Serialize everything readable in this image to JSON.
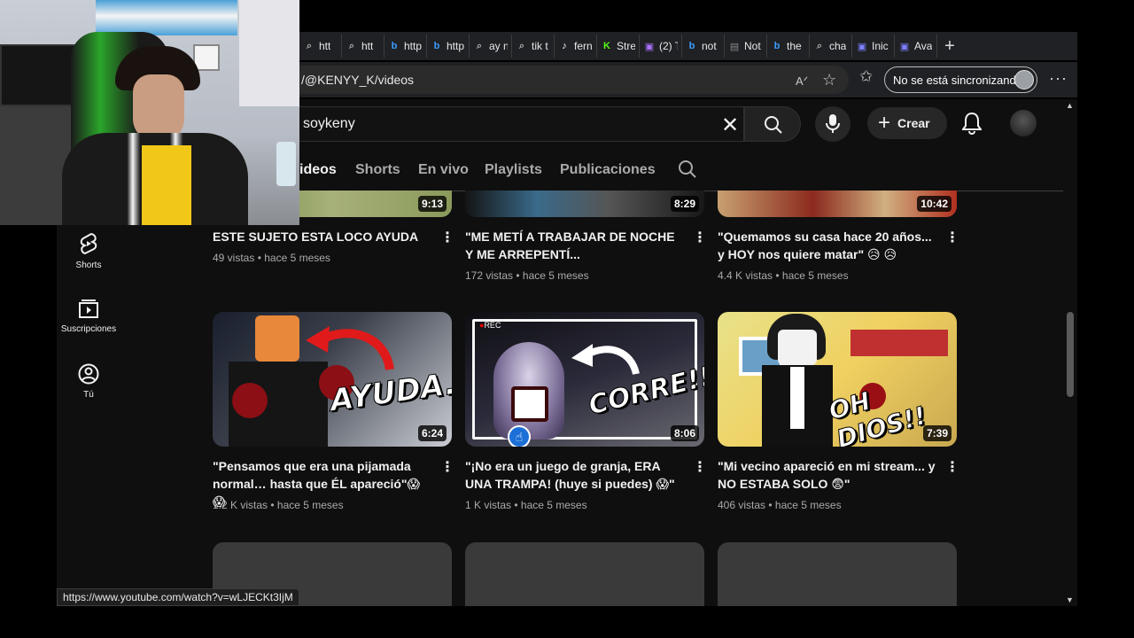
{
  "browser": {
    "tabs": [
      {
        "label": "htt",
        "icon": "search-icon"
      },
      {
        "label": "htt",
        "icon": "search-icon"
      },
      {
        "label": "http",
        "icon": "bing-icon"
      },
      {
        "label": "http",
        "icon": "bing-icon"
      },
      {
        "label": "ay n",
        "icon": "search-icon"
      },
      {
        "label": "tik t",
        "icon": "search-icon"
      },
      {
        "label": "fern",
        "icon": "tiktok-icon"
      },
      {
        "label": "Stre",
        "icon": "kick-icon"
      },
      {
        "label": "(2) T",
        "icon": "twitch-icon"
      },
      {
        "label": "not",
        "icon": "bing-icon"
      },
      {
        "label": "Not",
        "icon": "page-icon"
      },
      {
        "label": "the",
        "icon": "bing-icon"
      },
      {
        "label": "cha",
        "icon": "search-icon"
      },
      {
        "label": "Inic",
        "icon": "app-icon"
      },
      {
        "label": "Ava",
        "icon": "app-icon"
      }
    ],
    "url": "/@KENYY_K/videos",
    "sync_label": "No se está sincronizando",
    "status_url": "https://www.youtube.com/watch?v=wLJECKt3IjM"
  },
  "youtube": {
    "search_value": "soykeny",
    "create_label": "Crear",
    "channel_tabs": [
      "ideos",
      "Shorts",
      "En vivo",
      "Playlists",
      "Publicaciones"
    ],
    "sidebar": [
      {
        "label": "Shorts",
        "icon": "shorts-icon"
      },
      {
        "label": "Suscripciones",
        "icon": "subscriptions-icon"
      },
      {
        "label": "Tú",
        "icon": "you-icon"
      }
    ],
    "row1": [
      {
        "duration": "9:13",
        "title": "ESTE SUJETO ESTA LOCO AYUDA",
        "meta": "49 vistas • hace 5 meses"
      },
      {
        "duration": "8:29",
        "title": "\"ME METÍ A TRABAJAR DE NOCHE Y ME ARREPENTÍ...",
        "meta": "172 vistas • hace 5 meses"
      },
      {
        "duration": "10:42",
        "title": "\"Quemamos su casa hace 20 años... y HOY nos quiere matar\" 😥 😥",
        "meta": "4.4 K vistas • hace 5 meses"
      }
    ],
    "row2": [
      {
        "duration": "6:24",
        "title": "\"Pensamos que era una pijamada normal… hasta que ÉL apareció\"😱😱",
        "meta": "1.2 K vistas • hace 5 meses",
        "thumb_text": "AYUDA.."
      },
      {
        "duration": "8:06",
        "title": "\"¡No era un juego de granja, ERA UNA TRAMPA! (huye si puedes) 😱\"",
        "meta": "1 K vistas • hace 5 meses",
        "thumb_text": "CORRE!!",
        "rec_label": "REC"
      },
      {
        "duration": "7:39",
        "title": "\"Mi vecino apareció en mi stream... y NO ESTABA SOLO 😨\"",
        "meta": "406 vistas • hace 5 meses",
        "thumb_text": "OH DIOS!!"
      }
    ]
  }
}
